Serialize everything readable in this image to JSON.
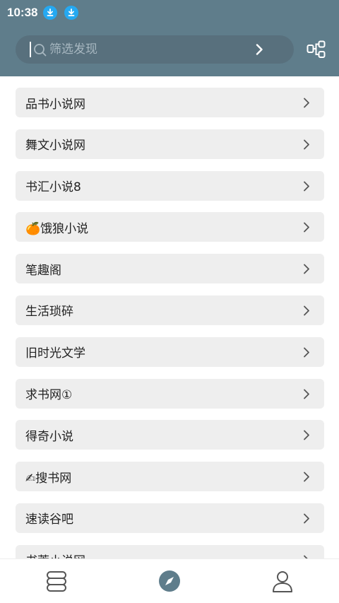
{
  "status_bar": {
    "time": "10:38",
    "icons": [
      "download-icon",
      "download-icon"
    ]
  },
  "search": {
    "placeholder": "筛选发现"
  },
  "colors": {
    "header": "#5f7d8b",
    "item_bg": "#eeeeee",
    "accent": "#5f7d8b",
    "download_badge": "#25a9f2"
  },
  "sources": [
    {
      "label": "品书小说网"
    },
    {
      "label": "舞文小说网"
    },
    {
      "label": "书汇小说8"
    },
    {
      "label": "🍊饿狼小说"
    },
    {
      "label": "笔趣阁"
    },
    {
      "label": "生活琐碎"
    },
    {
      "label": "旧时光文学"
    },
    {
      "label": "求书网①"
    },
    {
      "label": "得奇小说"
    },
    {
      "label": "✍搜书网"
    },
    {
      "label": "速读谷吧"
    },
    {
      "label": "书荒小说网"
    }
  ],
  "bottom_nav": {
    "items": [
      {
        "icon": "bookshelf-icon",
        "active": false
      },
      {
        "icon": "compass-icon",
        "active": true
      },
      {
        "icon": "profile-icon",
        "active": false
      }
    ]
  }
}
